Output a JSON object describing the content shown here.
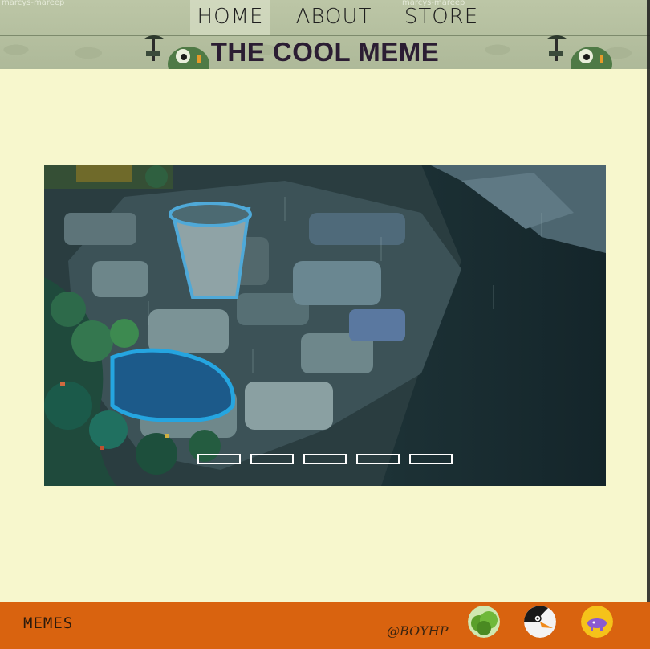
{
  "header": {
    "credit_left": "marcys-mareep",
    "credit_right": "marcys-mareep",
    "title": "THE COOL MEME",
    "nav": [
      {
        "label": "HOME",
        "active": true
      },
      {
        "label": "ABOUT",
        "active": false
      },
      {
        "label": "STORE",
        "active": false
      }
    ]
  },
  "carousel": {
    "slide_description_icon": "rainy-pixel-garden-image",
    "slide_count": 5
  },
  "footer": {
    "brand": "MEMES",
    "handle": "@BOYHP",
    "avatars": [
      "lettuce-avatar",
      "penguin-avatar",
      "purple-creature-avatar"
    ]
  },
  "colors": {
    "page_bg": "#f7f7cd",
    "header_bg": "#b8c2a2",
    "footer_bg": "#d9630f",
    "title_color": "#2b1d33"
  }
}
